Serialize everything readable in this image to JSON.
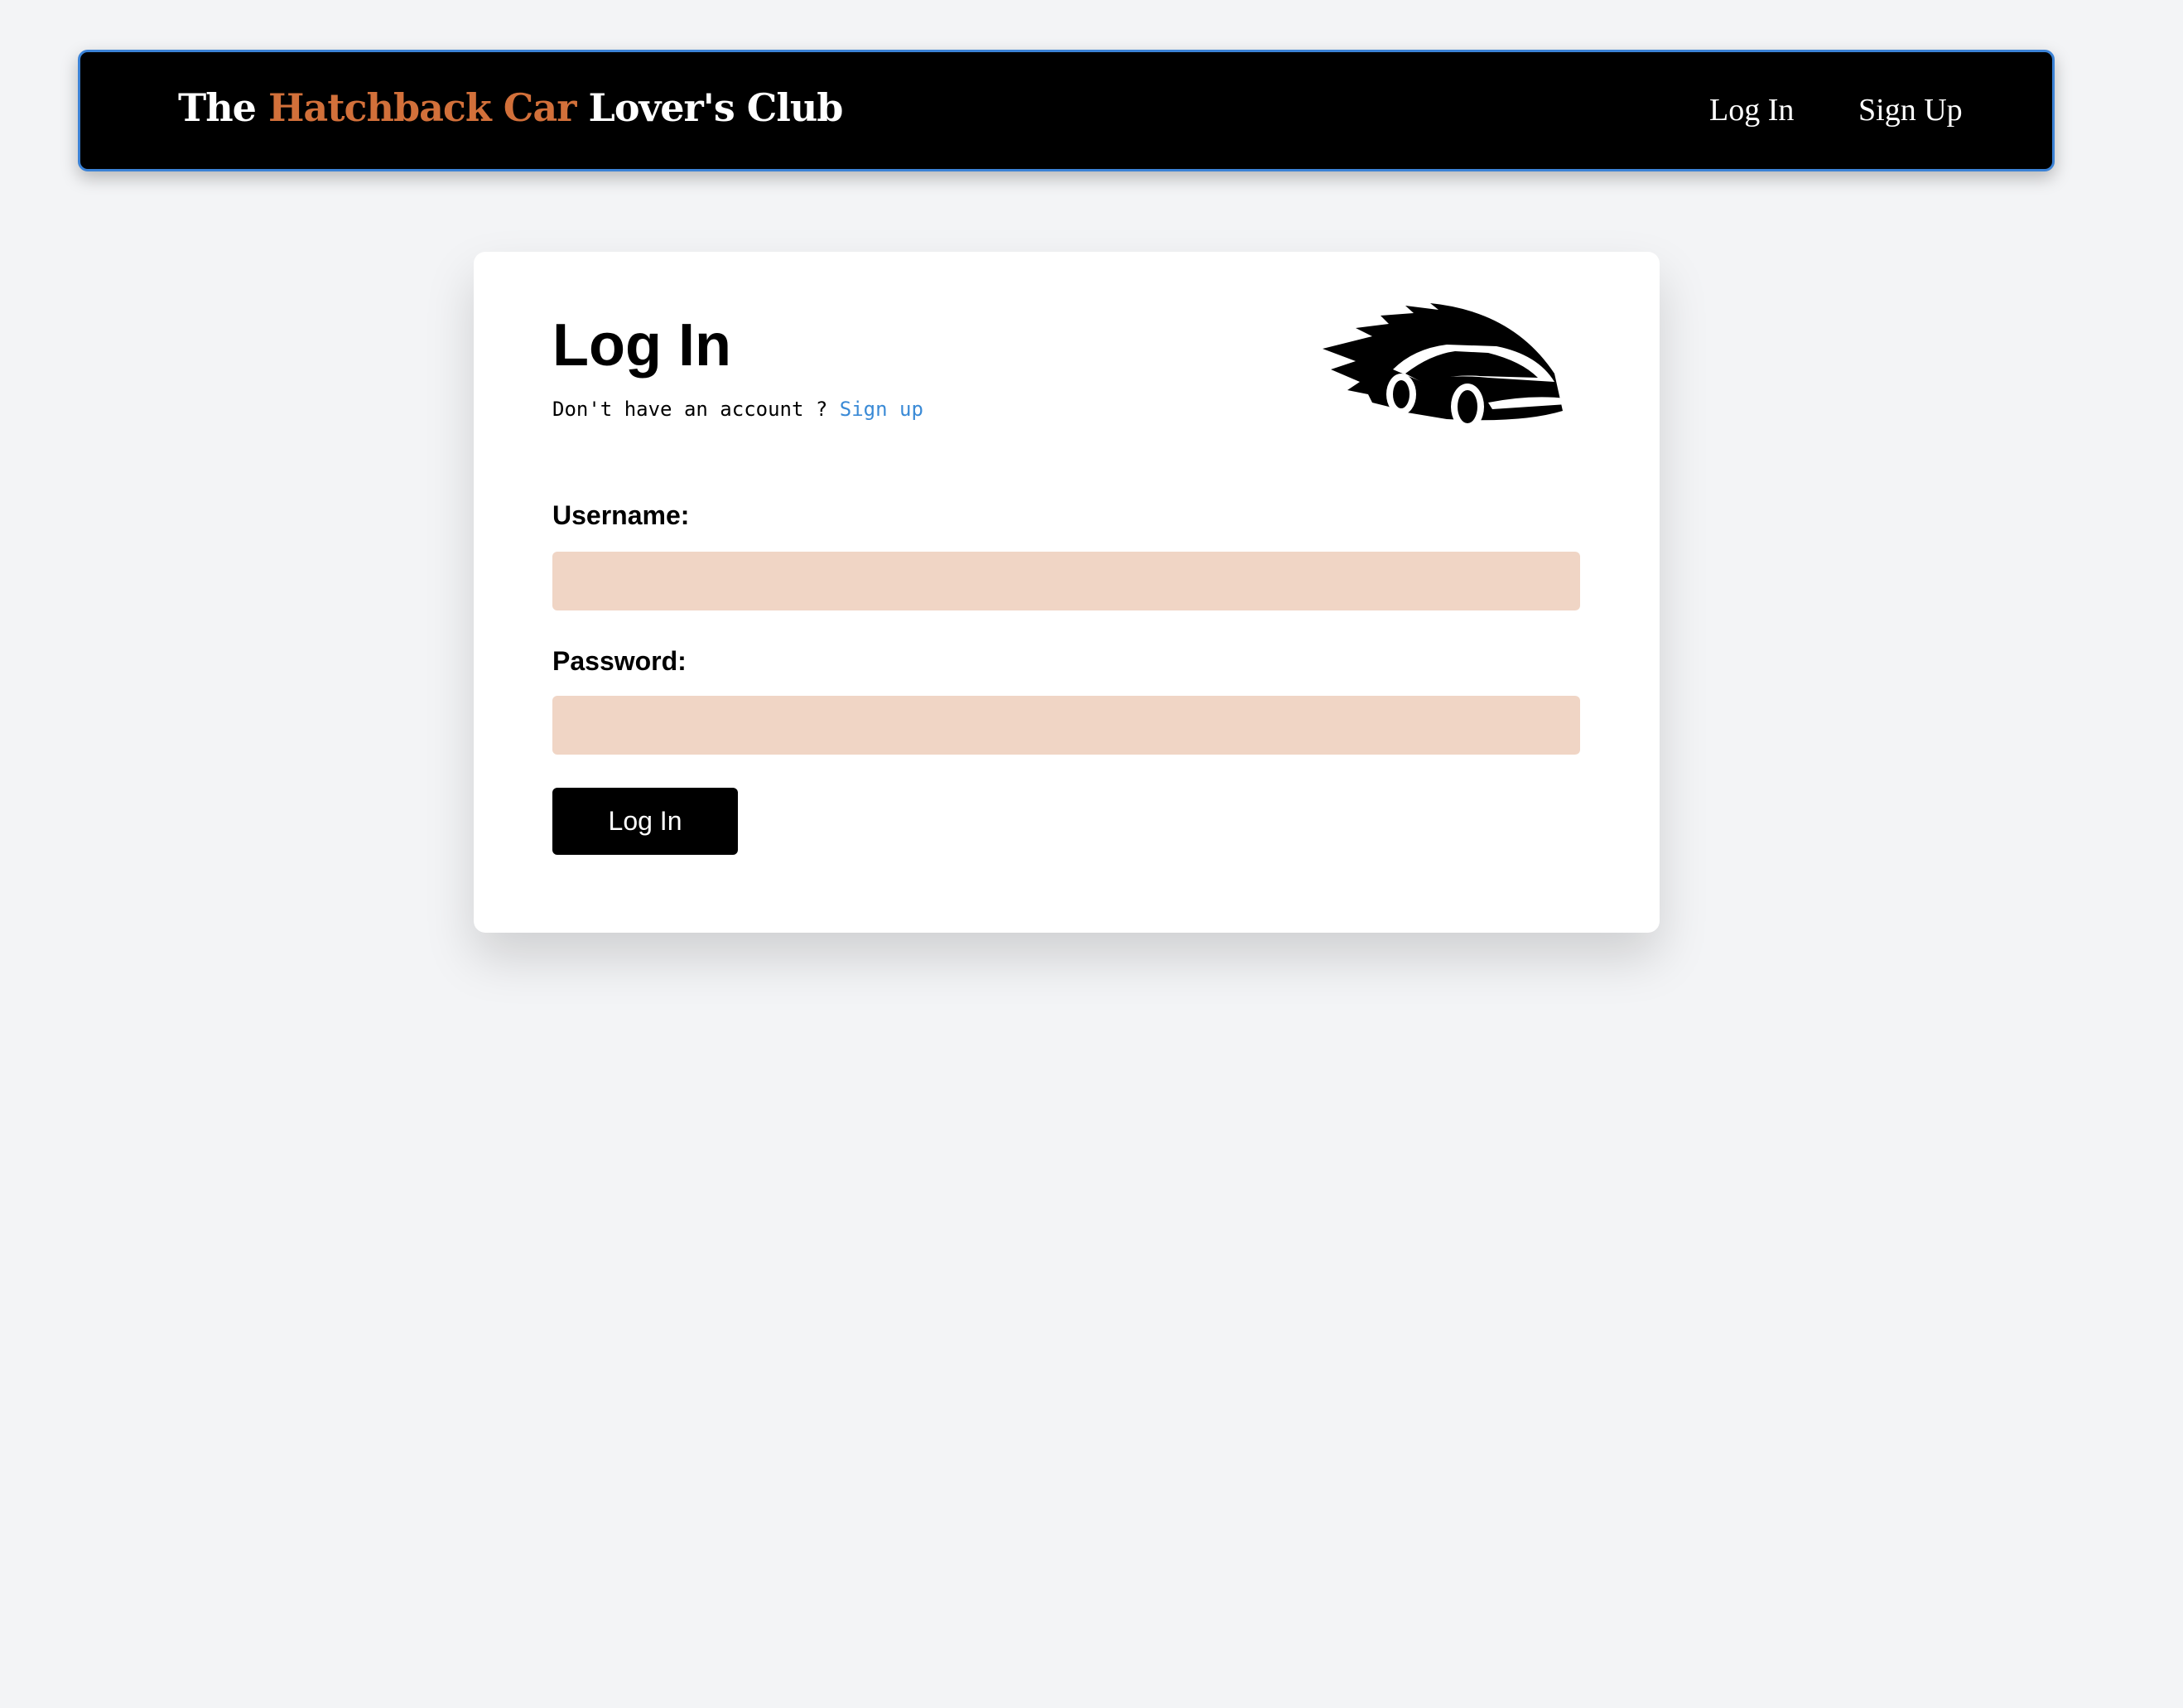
{
  "header": {
    "brand_pre": "The ",
    "brand_highlight": "Hatchback Car",
    "brand_post": " Lover's Club",
    "nav": {
      "login": "Log In",
      "signup": "Sign Up"
    }
  },
  "card": {
    "title": "Log In",
    "subtitle": "Don't have an account ? ",
    "signup_link": "Sign up",
    "username_label": "Username:",
    "username_value": "",
    "password_label": "Password:",
    "password_value": "",
    "submit": "Log In",
    "logo_icon": "speeding-car-icon"
  },
  "colors": {
    "accent": "#d2703a",
    "link": "#3a8ad6",
    "input_bg": "#f0d5c5"
  }
}
